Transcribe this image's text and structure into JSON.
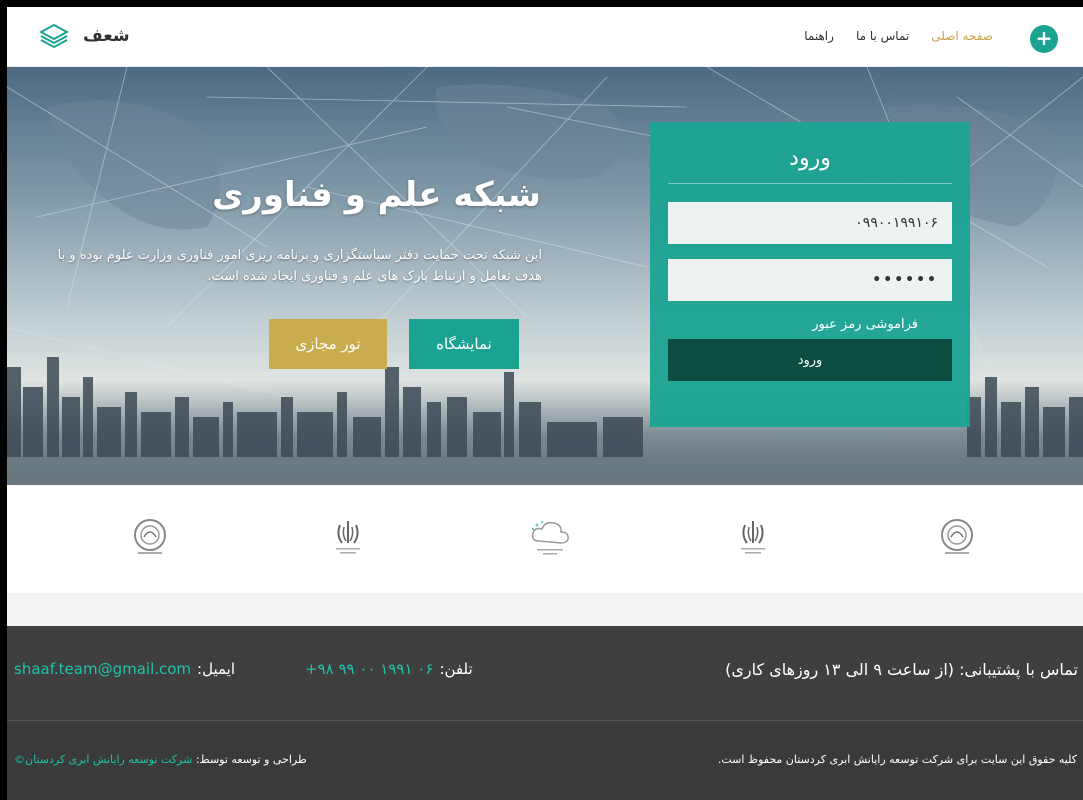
{
  "nav": {
    "brand": "شعف",
    "menu": [
      "صفحه اصلی",
      "تماس با ما",
      "راهنما"
    ],
    "plus_label": "+"
  },
  "hero": {
    "title": "شبکه علم و فناوری",
    "description": "این شبکه تحت حمایت دفتر سیاستگزاری و برنامه ریزی امور فناوری وزارت علوم بوده و با هدف تعامل و ارتباط پارک های علم و فناوری ایجاد شده است.",
    "btn_expo": "نمایشگاه",
    "btn_tour": "تور مجازی"
  },
  "login": {
    "title": "ورود",
    "username_value": "۰۹۹۰۰۱۹۹۱۰۶",
    "password_value": "••••••",
    "forgot": "فراموشی رمز عبور",
    "submit": "ورود"
  },
  "logos": [
    "seal-logo",
    "iran-emblem-logo",
    "cloud-logo",
    "iran-emblem-logo",
    "seal-logo"
  ],
  "footer": {
    "support": "تماس با پشتیبانی: (از ساعت ۹ الی ۱۳ روزهای کاری)",
    "tel_label": "تلفن:",
    "tel_value": "۰۶ ۱۹۹۱ ۰۰ ۹۹ ۹۸+",
    "email_label": "ایمیل:",
    "email_value": "shaaf.team@gmail.com",
    "copyright": "کلیه حقوق این سایت برای شرکت توسعه رایانش ابری کردستان محفوظ است.",
    "dev_label": "طراحی و توسعه توسط:",
    "dev_value": "شرکت توسعه رایانش ابری کردستان©"
  },
  "colors": {
    "accent": "#1aa391",
    "gold": "#c9ac4d",
    "dark_green": "#0c4d42",
    "footer": "#3f3f3f"
  }
}
